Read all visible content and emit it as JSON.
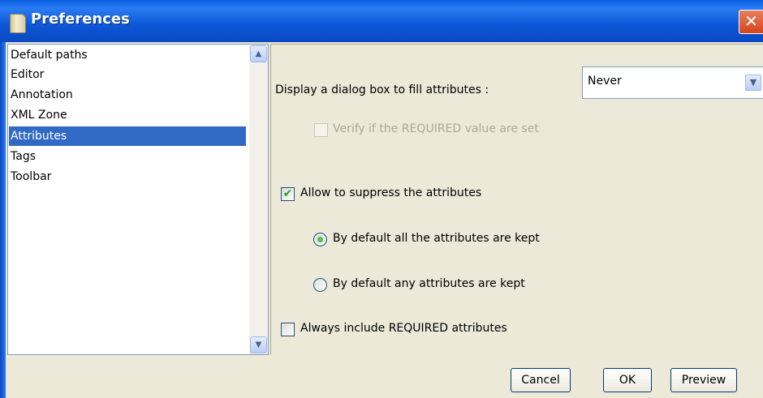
{
  "window": {
    "title": "Preferences",
    "close_symbol": "✕"
  },
  "categories": [
    {
      "label": "Default paths",
      "selected": false
    },
    {
      "label": "Editor",
      "selected": false
    },
    {
      "label": "Annotation",
      "selected": false
    },
    {
      "label": "XML Zone",
      "selected": false
    },
    {
      "label": "Attributes",
      "selected": true
    },
    {
      "label": "Tags",
      "selected": false
    },
    {
      "label": "Toolbar",
      "selected": false
    }
  ],
  "scrollbar": {
    "up_icon": "▲",
    "down_icon": "▼"
  },
  "attributes": {
    "dialog_label": "Display a dialog box to fill attributes :",
    "dialog_select": {
      "value": "Never",
      "arrow_icon": "▼"
    },
    "verify_required": {
      "label": "Verify if the REQUIRED value are set",
      "checked": false,
      "enabled": false
    },
    "allow_suppress": {
      "label": "Allow to suppress the attributes",
      "checked": true,
      "check_glyph": "✔"
    },
    "radio_all_kept": {
      "label": "By default all the attributes are kept",
      "selected": true
    },
    "radio_any_kept": {
      "label": "By default any attributes are kept",
      "selected": false
    },
    "always_include": {
      "label": "Always include REQUIRED attributes",
      "checked": false
    }
  },
  "buttons": {
    "cancel": "Cancel",
    "ok": "OK",
    "preview": "Preview"
  },
  "colors": {
    "titlebar": "#0a5fe0",
    "selection": "#316ac5",
    "dialog_bg": "#ece9d8",
    "checkmark": "#21a121"
  }
}
